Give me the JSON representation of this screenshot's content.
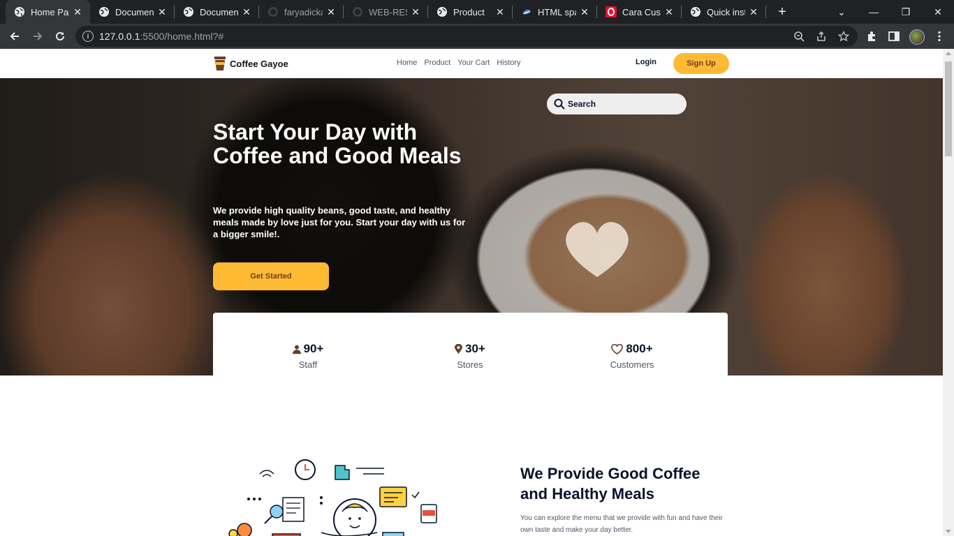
{
  "browser": {
    "tabs": [
      {
        "title": "Home Page",
        "favicon": "globe-icon",
        "active": true
      },
      {
        "title": "Document",
        "favicon": "globe-icon",
        "active": false
      },
      {
        "title": "Document",
        "favicon": "globe-icon",
        "active": false
      },
      {
        "title": "faryadicka",
        "favicon": "github-icon",
        "active": false
      },
      {
        "title": "WEB-RESP",
        "favicon": "github-icon",
        "active": false
      },
      {
        "title": "Product",
        "favicon": "globe-icon",
        "active": false
      },
      {
        "title": "HTML span",
        "favicon": "html-span-icon",
        "active": false
      },
      {
        "title": "Cara Custo",
        "favicon": "opera-icon",
        "active": false
      },
      {
        "title": "Quick insta",
        "favicon": "globe-icon",
        "active": false
      }
    ],
    "url_host": "127.0.0.1",
    "url_rest": ":5500/home.html?#"
  },
  "site": {
    "brand": "Coffee Gayoe",
    "nav": [
      "Home",
      "Product",
      "Your Cart",
      "History"
    ],
    "login": "Login",
    "signup": "Sign Up",
    "search_placeholder": "Search"
  },
  "hero": {
    "title": "Start Your Day with Coffee and Good Meals",
    "subtitle": "We provide high quality beans, good taste, and healthy meals made by love just for you. Start your day with us for a bigger smile!.",
    "cta": "Get Started"
  },
  "stats": [
    {
      "value": "90+",
      "label": "Staff",
      "icon": "person-icon"
    },
    {
      "value": "30+",
      "label": "Stores",
      "icon": "location-pin-icon"
    },
    {
      "value": "800+",
      "label": "Customers",
      "icon": "heart-icon"
    }
  ],
  "section2": {
    "title": "We Provide Good Coffee and Healthy Meals",
    "text": "You can explore the menu that we provide with fun and have their own taste and make your day better."
  },
  "colors": {
    "accent": "#ffba33",
    "brown": "#6a4029",
    "dark": "#0b132a"
  }
}
